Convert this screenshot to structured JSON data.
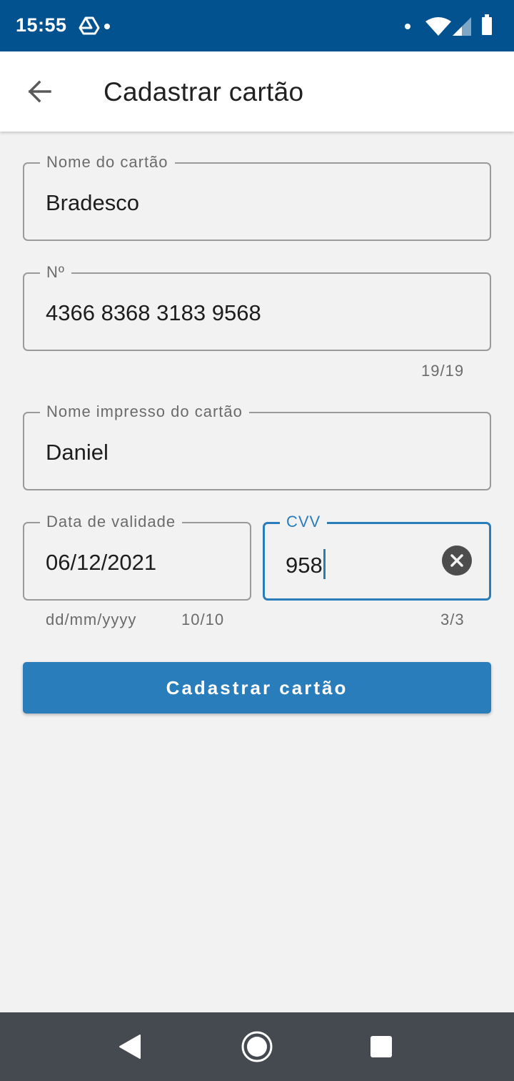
{
  "status_bar": {
    "time": "15:55",
    "background_color": "#02528f",
    "icons": [
      "drive-icon",
      "notification-dot-icon",
      "dot-icon",
      "wifi-icon",
      "signal-icon",
      "battery-icon"
    ]
  },
  "app_bar": {
    "title": "Cadastrar cartão",
    "back_icon": "arrow-left-icon"
  },
  "form": {
    "card_name": {
      "label": "Nome do cartão",
      "value": "Bradesco"
    },
    "card_number": {
      "label": "Nº",
      "value": "4366 8368 3183 9568",
      "counter": "19/19"
    },
    "printed_name": {
      "label": "Nome impresso do cartão",
      "value": "Daniel"
    },
    "expiry": {
      "label": "Data de validade",
      "value": "06/12/2021",
      "helper": "dd/mm/yyyy",
      "counter": "10/10"
    },
    "cvv": {
      "label": "CVV",
      "value": "958",
      "counter": "3/3",
      "focused": true
    }
  },
  "submit_button": {
    "label": "Cadastrar cartão"
  },
  "colors": {
    "accent": "#2a7dbb",
    "background": "#f2f2f2",
    "nav_bar": "#454a50"
  },
  "nav_bar": {
    "buttons": [
      "back-triangle-icon",
      "home-circle-icon",
      "recents-square-icon"
    ]
  }
}
